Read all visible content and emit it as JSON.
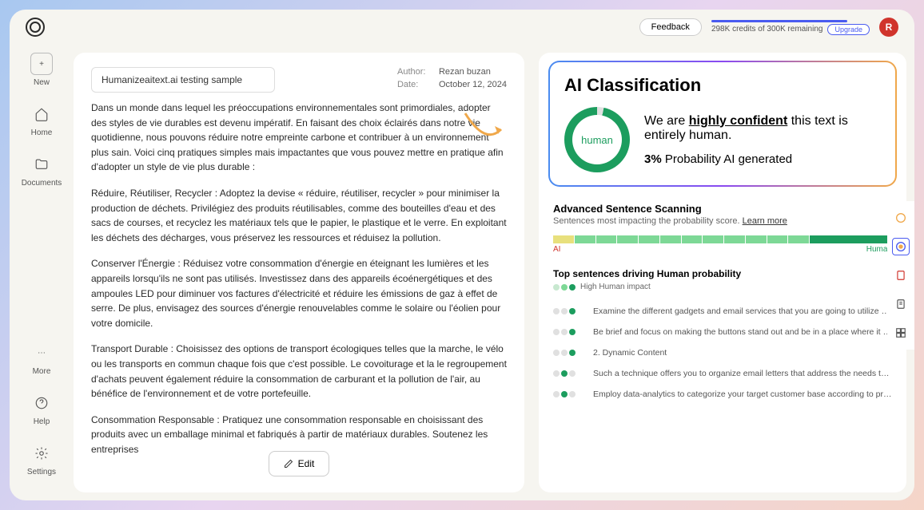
{
  "topbar": {
    "feedback": "Feedback",
    "credits": "298K credits of 300K remaining",
    "upgrade": "Upgrade",
    "avatar": "R"
  },
  "sidebar": {
    "new": "New",
    "home": "Home",
    "documents": "Documents",
    "more": "More",
    "help": "Help",
    "settings": "Settings"
  },
  "doc": {
    "title": "Humanizeaitext.ai testing sample",
    "author_label": "Author:",
    "author": "Rezan buzan",
    "date_label": "Date:",
    "date": "October 12, 2024",
    "p1": "Dans un monde dans lequel les préoccupations environnementales sont primordiales, adopter des styles de vie durables est devenu impératif. En faisant des choix éclairés dans notre vie quotidienne, nous pouvons réduire notre empreinte carbone et contribuer à un environnement plus sain. Voici cinq pratiques simples mais impactantes que vous pouvez mettre en pratique afin d'adopter un style de vie plus durable :",
    "p2": "Réduire, Réutiliser, Recycler : Adoptez la devise « réduire, réutiliser, recycler » pour minimiser la production de déchets. Privilégiez des produits réutilisables, comme des bouteilles d'eau et des sacs de courses, et recyclez les matériaux tels que le papier, le plastique et le verre. En exploitant les déchets des décharges, vous préservez les ressources et réduisez la pollution.",
    "p3": "Conserver l'Énergie : Réduisez votre consommation d'énergie en éteignant les lumières et les appareils lorsqu'ils ne sont pas utilisés. Investissez dans des appareils écoénergétiques et des ampoules LED pour diminuer vos factures d'électricité et réduire les émissions de gaz à effet de serre. De plus, envisagez des sources d'énergie renouvelables comme le solaire ou l'éolien pour votre domicile.",
    "p4": "Transport Durable : Choisissez des options de transport écologiques telles que la marche, le vélo ou les transports en commun chaque fois que c'est possible. Le covoiturage et la le regroupement d'achats peuvent également réduire la consommation de carburant et la pollution de l'air, au bénéfice de l'environnement et de votre portefeuille.",
    "p5": "Consommation Responsable : Pratiquez une consommation responsable en choisissant des produits avec un emballage minimal et fabriqués à partir de matériaux durables. Soutenez les entreprises",
    "edit": "Edit"
  },
  "class": {
    "title": "AI Classification",
    "gauge": "human",
    "conf_pre": "We are ",
    "conf_bold": "highly confident",
    "conf_post": " this text is entirely human.",
    "prob_pct": "3%",
    "prob_text": " Probability AI generated"
  },
  "adv": {
    "title": "Advanced Sentence Scanning",
    "sub": "Sentences most impacting the probability score. ",
    "learn": "Learn more",
    "ai": "AI",
    "human": "Human"
  },
  "topsent": {
    "title": "Top sentences driving Human probability",
    "legend": "High Human impact",
    "rows": [
      "Examine the different gadgets and email services that you are going to utilize and assure that...",
      "Be brief and focus on making the buttons stand out and be in a place where it is easy for the...",
      "2. Dynamic Content",
      "Such a technique offers you to organize email letters that address the needs the best and,...",
      "Employ data-analytics to categorize your target customer base according to preferences,..."
    ]
  }
}
